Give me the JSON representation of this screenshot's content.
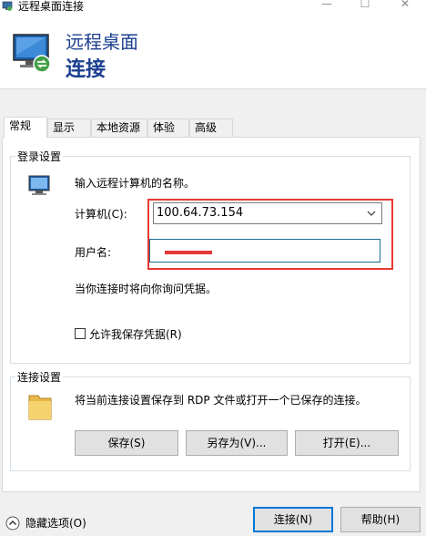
{
  "window": {
    "title": "远程桌面连接",
    "minimize_label": "—",
    "maximize_label": "☐",
    "close_label": "✕"
  },
  "header": {
    "line1": "远程桌面",
    "line2": "连接"
  },
  "tabs": [
    {
      "label": "常规",
      "active": true
    },
    {
      "label": "显示",
      "active": false
    },
    {
      "label": "本地资源",
      "active": false
    },
    {
      "label": "体验",
      "active": false
    },
    {
      "label": "高级",
      "active": false
    }
  ],
  "login": {
    "legend": "登录设置",
    "instruction": "输入远程计算机的名称。",
    "computer_label": "计算机(C):",
    "computer_value": "100.64.73.154",
    "username_label": "用户名:",
    "username_value": "",
    "credential_note": "当你连接时将向你询问凭据。",
    "save_credentials_label": "允许我保存凭据(R)",
    "save_credentials_checked": false
  },
  "connection": {
    "legend": "连接设置",
    "description": "将当前连接设置保存到 RDP 文件或打开一个已保存的连接。",
    "save_label": "保存(S)",
    "save_as_label": "另存为(V)...",
    "open_label": "打开(E)..."
  },
  "footer": {
    "hide_options_label": "隐藏选项(O)",
    "connect_label": "连接(N)",
    "help_label": "帮助(H)"
  },
  "colors": {
    "header_text": "#1b3f8f",
    "highlight": "#e53935",
    "focus_border": "#0078d7"
  }
}
